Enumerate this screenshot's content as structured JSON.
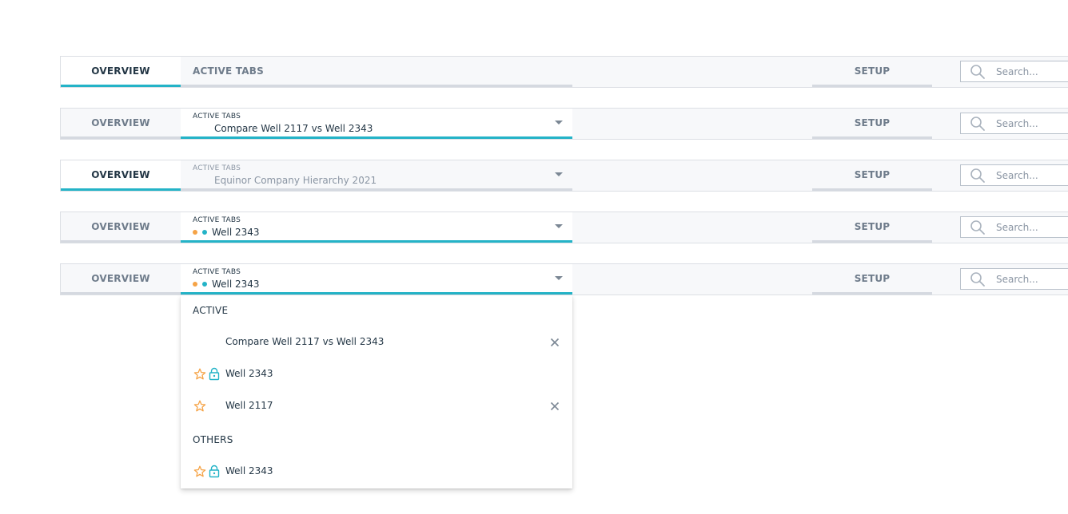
{
  "tabbars": [
    {
      "overview": "OVERVIEW",
      "active_tabs_label": "ACTIVE TABS",
      "setup": "SETUP",
      "search_placeholder": "Search..."
    },
    {
      "overview": "OVERVIEW",
      "active_tabs_label": "ACTIVE TABS",
      "selected": "Compare Well 2117 vs Well 2343",
      "setup": "SETUP",
      "search_placeholder": "Search..."
    },
    {
      "overview": "OVERVIEW",
      "active_tabs_label": "ACTIVE TABS",
      "selected": "Equinor Company Hierarchy 2021",
      "setup": "SETUP",
      "search_placeholder": "Search..."
    },
    {
      "overview": "OVERVIEW",
      "active_tabs_label": "ACTIVE TABS",
      "selected": "Well 2343",
      "setup": "SETUP",
      "search_placeholder": "Search..."
    },
    {
      "overview": "OVERVIEW",
      "active_tabs_label": "ACTIVE TABS",
      "selected": "Well 2343",
      "setup": "SETUP",
      "search_placeholder": "Search..."
    }
  ],
  "dropdown": {
    "active_header": "ACTIVE",
    "active_items": [
      {
        "label": "Compare Well 2117 vs Well 2343",
        "icons": [
          "close-icon"
        ]
      },
      {
        "label": "Well 2343",
        "icons": [
          "star-icon",
          "lock-icon"
        ]
      },
      {
        "label": "Well 2117",
        "icons": [
          "star-icon",
          "close-icon"
        ]
      }
    ],
    "others_header": "OTHERS",
    "other_items": [
      {
        "label": "Well 2343",
        "icons": [
          "star-icon",
          "lock-icon"
        ]
      }
    ]
  },
  "colors": {
    "accent": "#24b3c7",
    "favorite": "#f5a346",
    "text": "#243746",
    "muted": "#6f7c8b"
  }
}
